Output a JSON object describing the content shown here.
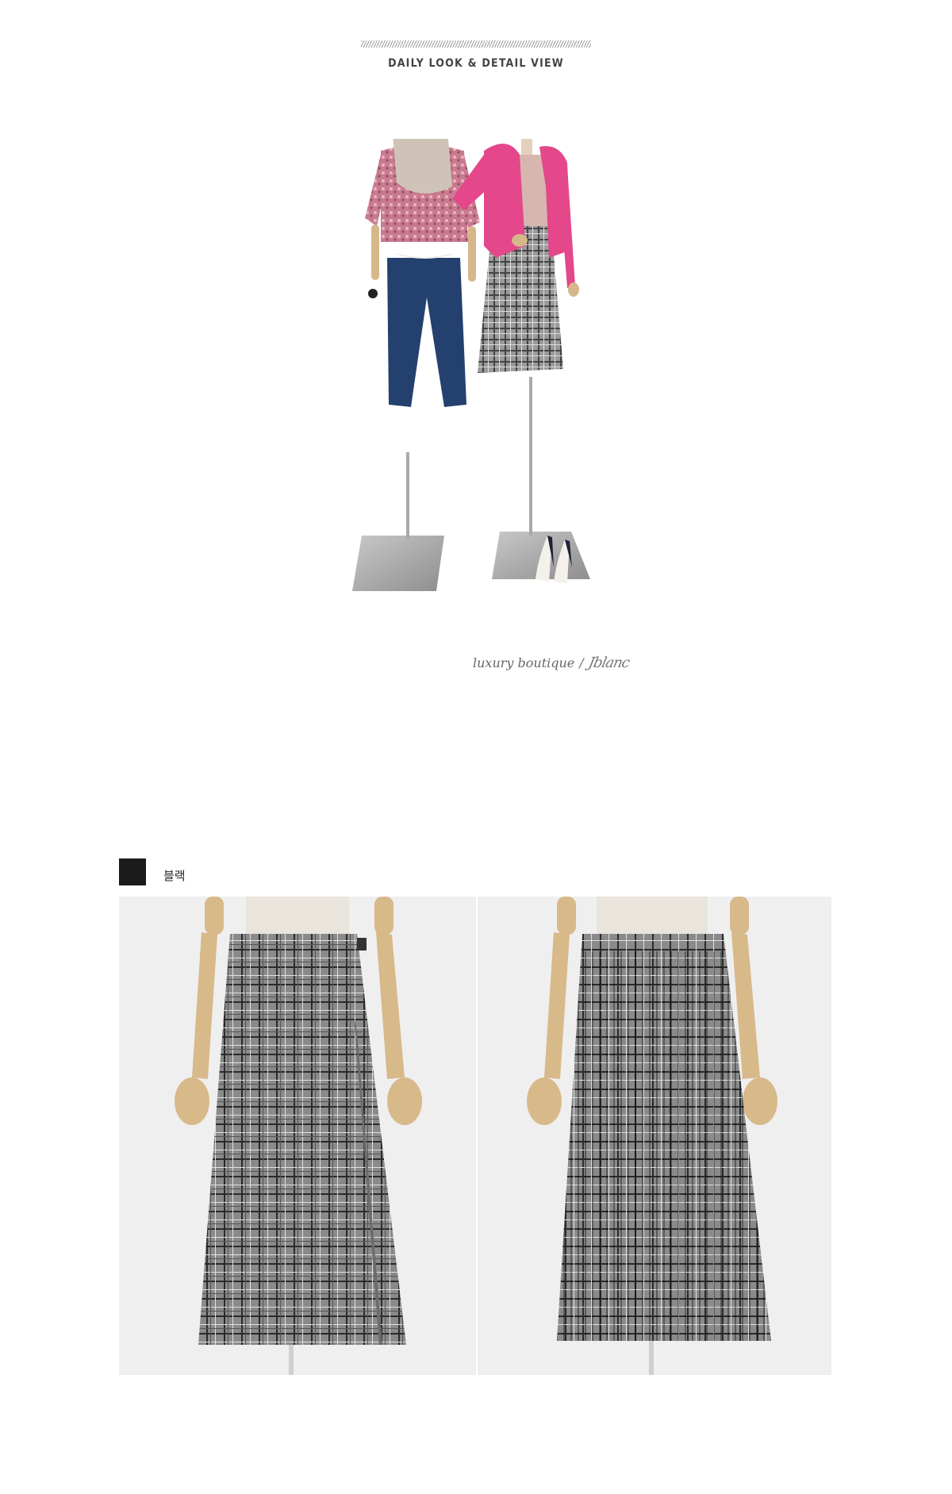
{
  "section": {
    "title": "DAILY LOOK & DETAIL VIEW"
  },
  "signature": {
    "brand_text": "luxury boutique",
    "divider": "/",
    "script_text": "Jblanc"
  },
  "color_option": {
    "label": "블랙",
    "swatch_color": "#1b1b1b"
  },
  "colors": {
    "plaid_base": "#8a8a8a",
    "plaid_dark": "#2a2a2a",
    "mannequin_wood": "#d8b98a",
    "jacket_pink": "#e4478a",
    "denim": "#24406e",
    "background_gray": "#efefef"
  }
}
